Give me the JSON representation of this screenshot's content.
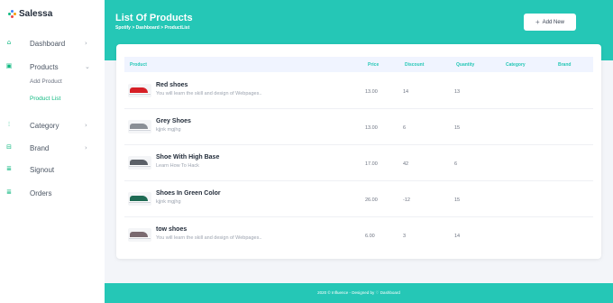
{
  "brand": {
    "name": "Salessa",
    "colors": [
      "#3b82f6",
      "#10b981",
      "#f59e0b",
      "#ef4444"
    ]
  },
  "sidebar": {
    "items": [
      {
        "label": "Dashboard",
        "icon": "home-icon",
        "chevron": "›"
      },
      {
        "label": "Products",
        "icon": "product-icon",
        "chevron": "⌄"
      },
      {
        "label": "Category",
        "icon": "category-icon",
        "chevron": "›"
      },
      {
        "label": "Brand",
        "icon": "brand-icon",
        "chevron": "›"
      },
      {
        "label": "Signout",
        "icon": "signout-icon"
      },
      {
        "label": "Orders",
        "icon": "orders-icon"
      }
    ],
    "subitems": [
      {
        "label": "Add Product"
      },
      {
        "label": "Product List",
        "active": true
      }
    ]
  },
  "header": {
    "title": "List Of Products",
    "breadcrumb": "Spotify > Dashboard > ProductList",
    "add_button": "Add New"
  },
  "table": {
    "columns": [
      "Product",
      "Price",
      "Discount",
      "Quantity",
      "Category",
      "Brand"
    ],
    "rows": [
      {
        "name": "Red shoes",
        "desc": "You will learn the skill and design of Webpages..",
        "price": "13.00",
        "discount": "14",
        "quantity": "13",
        "category": "",
        "brand": "",
        "shoe_color": "#d61f26"
      },
      {
        "name": "Grey Shoes",
        "desc": "kjjnk mgjhg",
        "price": "13.00",
        "discount": "6",
        "quantity": "15",
        "category": "",
        "brand": "",
        "shoe_color": "#8a8f96"
      },
      {
        "name": "Shoe With High Base",
        "desc": "Learn How To Hack",
        "price": "17.00",
        "discount": "42",
        "quantity": "6",
        "category": "",
        "brand": "",
        "shoe_color": "#5b6068"
      },
      {
        "name": "Shoes In Green Color",
        "desc": "kjjnk mgjhg",
        "price": "26.00",
        "discount": "-12",
        "quantity": "15",
        "category": "",
        "brand": "",
        "shoe_color": "#1f6b54"
      },
      {
        "name": "tow shoes",
        "desc": "You will learn the skill and design of Webpages..",
        "price": "6.00",
        "discount": "3",
        "quantity": "14",
        "category": "",
        "brand": "",
        "shoe_color": "#7a6a70"
      }
    ]
  },
  "footer": {
    "text": "2020 © Influence - Designed by ♡ Dashboard"
  },
  "colors": {
    "accent": "#25c7b6",
    "sidebar_active": "#10b981"
  }
}
